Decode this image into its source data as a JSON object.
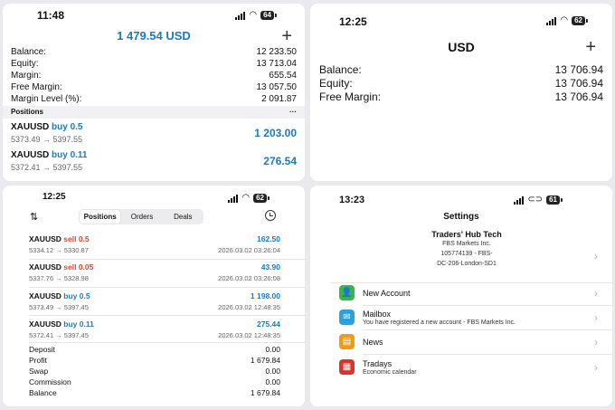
{
  "panel1": {
    "time": "11:48",
    "battery": "64",
    "header_value": "1 479.54 USD",
    "account": [
      {
        "label": "Balance:",
        "value": "12 233.50"
      },
      {
        "label": "Equity:",
        "value": "13 713.04"
      },
      {
        "label": "Margin:",
        "value": "655.54"
      },
      {
        "label": "Free Margin:",
        "value": "13 057.50"
      },
      {
        "label": "Margin Level (%):",
        "value": "2 091.87"
      }
    ],
    "positions_title": "Positions",
    "more": "···",
    "positions": [
      {
        "symbol": "XAUUSD",
        "side": "buy 0.5",
        "prices": "5373.49 → 5397.55",
        "profit": "1 203.00"
      },
      {
        "symbol": "XAUUSD",
        "side": "buy 0.11",
        "prices": "5372.41 → 5397.55",
        "profit": "276.54"
      }
    ]
  },
  "panel2": {
    "time": "12:25",
    "battery": "62",
    "header": "USD",
    "rows": [
      {
        "label": "Balance:",
        "value": "13 706.94"
      },
      {
        "label": "Equity:",
        "value": "13 706.94"
      },
      {
        "label": "Free Margin:",
        "value": "13 706.94"
      }
    ]
  },
  "panel3": {
    "time": "12:25",
    "battery": "62",
    "tabs": [
      "Positions",
      "Orders",
      "Deals"
    ],
    "positions": [
      {
        "symbol": "XAUUSD",
        "side": "sell 0.5",
        "type": "sell",
        "prices": "5334.12 → 5330.87",
        "profit": "162.50",
        "time": "2026.03.02 03:26:04"
      },
      {
        "symbol": "XAUUSD",
        "side": "sell 0.05",
        "type": "sell",
        "prices": "5337.76 → 5328.98",
        "profit": "43.90",
        "time": "2026.03.02 03:26:08"
      },
      {
        "symbol": "XAUUSD",
        "side": "buy 0.5",
        "type": "buy",
        "prices": "5373.49 → 5397.45",
        "profit": "1 198.00",
        "time": "2026.03.02 12:48:35"
      },
      {
        "symbol": "XAUUSD",
        "side": "buy 0.11",
        "type": "buy",
        "prices": "5372.41 → 5397.45",
        "profit": "275.44",
        "time": "2026.03.02 12:48:35"
      }
    ],
    "summary": [
      {
        "label": "Deposit",
        "value": "0.00"
      },
      {
        "label": "Profit",
        "value": "1 679.84"
      },
      {
        "label": "Swap",
        "value": "0.00"
      },
      {
        "label": "Commission",
        "value": "0.00"
      },
      {
        "label": "Balance",
        "value": "1 679.84"
      }
    ]
  },
  "panel4": {
    "time": "13:23",
    "battery": "61",
    "title": "Settings",
    "account_name": "Traders' Hub Tech",
    "broker": "FBS Markets Inc.",
    "account_line": "105774139 - FBS-",
    "server": "DC-206-London-SD1",
    "menu": [
      {
        "title": "New Account",
        "subtitle": "",
        "color": "#3bb54a",
        "icon": "person-add-icon"
      },
      {
        "title": "Mailbox",
        "subtitle": "You have registered a new account - FBS Markets Inc.",
        "color": "#2aa0e0",
        "icon": "mail-icon"
      },
      {
        "title": "News",
        "subtitle": "",
        "color": "#f09a1a",
        "icon": "news-icon"
      },
      {
        "title": "Tradays",
        "subtitle": "Economic calendar",
        "color": "#d8342b",
        "icon": "calendar-icon"
      }
    ]
  },
  "colors": {
    "buy": "#1a7bc4",
    "sell": "#d9462f"
  }
}
